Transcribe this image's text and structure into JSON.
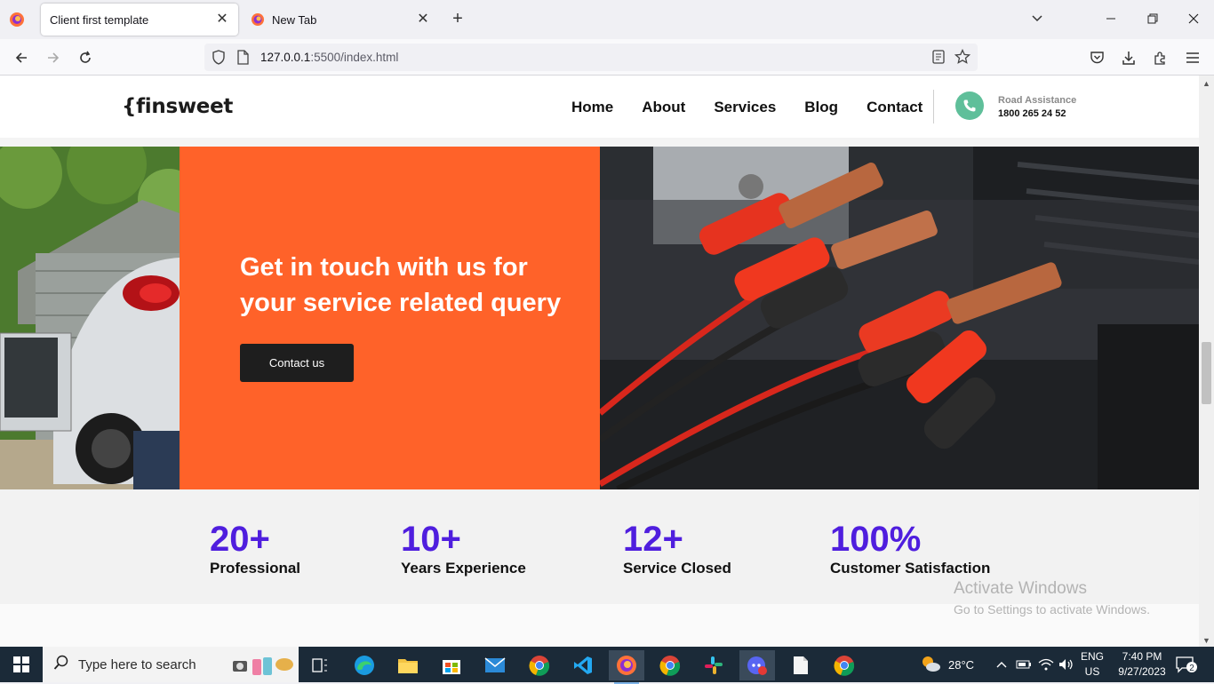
{
  "browser": {
    "tabs": [
      {
        "title": "Client first template",
        "active": true
      },
      {
        "title": "New Tab",
        "active": false
      }
    ],
    "url_host": "127.0.0.1",
    "url_rest": ":5500/index.html"
  },
  "site": {
    "logo": "{finsweet",
    "menu": [
      "Home",
      "About",
      "Services",
      "Blog",
      "Contact"
    ],
    "road_assistance_label": "Road Assistance",
    "road_assistance_phone": "1800 265 24 52"
  },
  "hero": {
    "title": "Get in touch with us for your service related query",
    "button": "Contact us"
  },
  "stats": [
    {
      "value": "20+",
      "label": "Professional"
    },
    {
      "value": "10+",
      "label": "Years Experience"
    },
    {
      "value": "12+",
      "label": "Service Closed"
    },
    {
      "value": "100%",
      "label": "Customer Satisfaction"
    }
  ],
  "watermark": {
    "line1": "Activate Windows",
    "line2": "Go to Settings to activate Windows."
  },
  "taskbar": {
    "search_placeholder": "Type here to search",
    "weather": "28°C",
    "lang_1": "ENG",
    "lang_2": "US",
    "time": "7:40 PM",
    "date": "9/27/2023",
    "notifications": "2"
  },
  "colors": {
    "accent_orange": "#ff6229",
    "stat_purple": "#4f1ede",
    "phone_green": "#5fbf9a"
  }
}
